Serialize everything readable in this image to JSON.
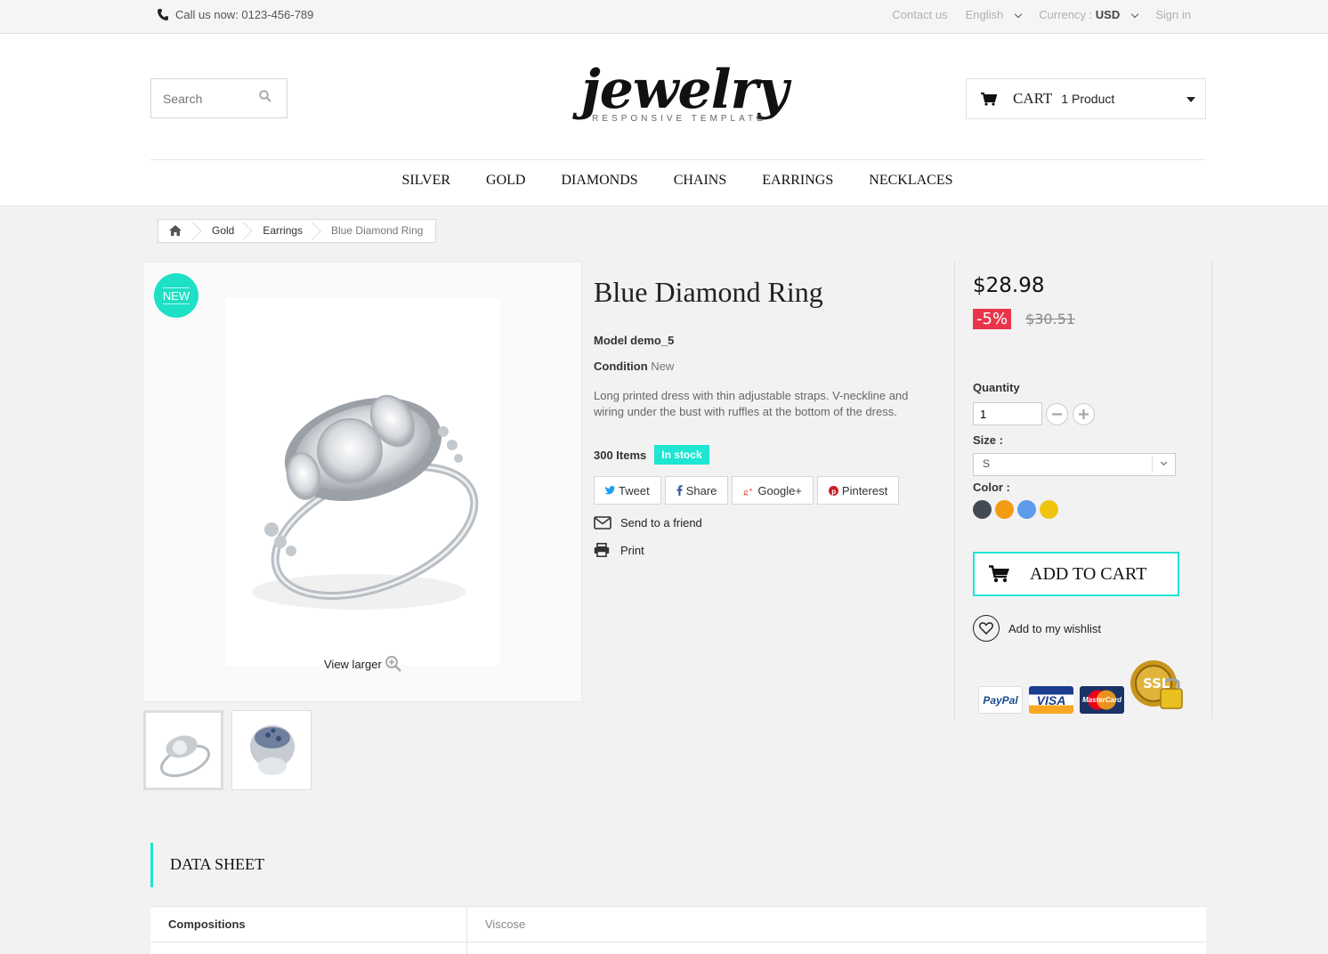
{
  "topbar": {
    "phone": "Call us now: 0123-456-789",
    "contact": "Contact us",
    "language": "English",
    "currency_label": "Currency :",
    "currency_value": "USD",
    "signin": "Sign in"
  },
  "header": {
    "search_placeholder": "Search",
    "logo_word": "jewelry",
    "logo_tagline": "RESPONSIVE TEMPLATE",
    "cart_label": "CART",
    "cart_count": "1 Product"
  },
  "nav": [
    "SILVER",
    "GOLD",
    "DIAMONDS",
    "CHAINS",
    "EARRINGS",
    "NECKLACES"
  ],
  "breadcrumb": [
    "Gold",
    "Earrings",
    "Blue Diamond Ring"
  ],
  "product": {
    "badge": "NEW",
    "view_larger": "View larger",
    "title": "Blue Diamond Ring",
    "model": "Model demo_5",
    "condition_label": "Condition",
    "condition_value": "New",
    "description": "Long printed dress with thin adjustable straps. V-neckline and wiring under the bust with ruffles at the bottom of the dress.",
    "items": "300 Items",
    "stock": "In stock",
    "social": {
      "tweet": "Tweet",
      "share": "Share",
      "google": "Google+",
      "pinterest": "Pinterest"
    },
    "send_friend": "Send to a friend",
    "print": "Print"
  },
  "buy": {
    "price": "$28.98",
    "discount": "-5%",
    "old_price": "$30.51",
    "quantity_label": "Quantity",
    "quantity_value": "1",
    "size_label": "Size :",
    "size_value": "S",
    "color_label": "Color :",
    "colors": [
      "#434a54",
      "#f39c11",
      "#5d9cec",
      "#f1c40f"
    ],
    "add_to_cart": "ADD TO CART",
    "wishlist": "Add to my wishlist",
    "payments": [
      "PayPal",
      "VISA",
      "MasterCard",
      "SSL"
    ]
  },
  "datasheet": {
    "title": "DATA SHEET",
    "rows": [
      {
        "key": "Compositions",
        "value": "Viscose"
      }
    ]
  },
  "colors": {
    "accent": "#1ee6d2",
    "discount": "#e8354b"
  }
}
